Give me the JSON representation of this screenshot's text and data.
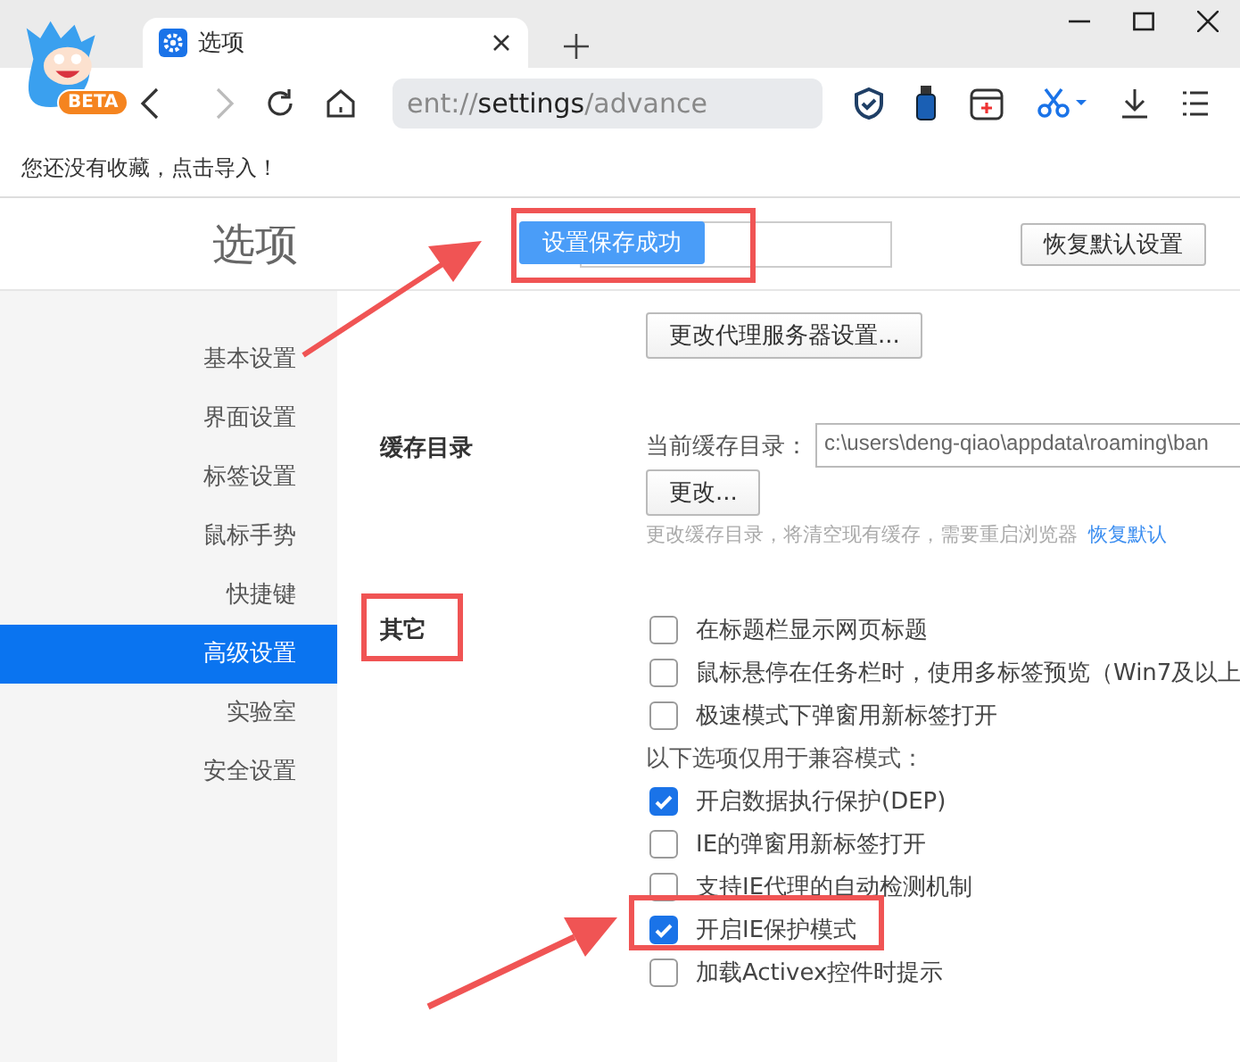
{
  "browser": {
    "logo_badge": "BETA",
    "tab_title": "选项",
    "address": {
      "scheme": "ent://",
      "host": "settings",
      "path": "/advance"
    },
    "forward_disabled": true,
    "bookmarks_hint": "您还没有收藏，点击导入！"
  },
  "header": {
    "title": "选项",
    "toast": "设置保存成功",
    "restore_button": "恢复默认设置"
  },
  "sidebar": {
    "items": [
      {
        "label": "基本设置",
        "selected": false
      },
      {
        "label": "界面设置",
        "selected": false
      },
      {
        "label": "标签设置",
        "selected": false
      },
      {
        "label": "鼠标手势",
        "selected": false
      },
      {
        "label": "快捷键",
        "selected": false
      },
      {
        "label": "高级设置",
        "selected": true
      },
      {
        "label": "实验室",
        "selected": false
      },
      {
        "label": "安全设置",
        "selected": false
      }
    ]
  },
  "proxy_button": "更改代理服务器设置...",
  "cache": {
    "label": "缓存目录",
    "field_label": "当前缓存目录：",
    "value": "c:\\users\\deng-qiao\\appdata\\roaming\\ban",
    "change_button": "更改...",
    "hint": "更改缓存目录，将清空现有缓存，需要重启浏览器",
    "restore_link": "恢复默认"
  },
  "other": {
    "label": "其它",
    "options": [
      {
        "kind": "checkbox",
        "label": "在标题栏显示网页标题",
        "checked": false
      },
      {
        "kind": "checkbox",
        "label": "鼠标悬停在任务栏时，使用多标签预览（Win7及以上",
        "checked": false
      },
      {
        "kind": "checkbox",
        "label": "极速模式下弹窗用新标签打开",
        "checked": false
      },
      {
        "kind": "note",
        "label": "以下选项仅用于兼容模式："
      },
      {
        "kind": "checkbox",
        "label": "开启数据执行保护(DEP)",
        "checked": true
      },
      {
        "kind": "checkbox",
        "label": "IE的弹窗用新标签打开",
        "checked": false
      },
      {
        "kind": "checkbox",
        "label": "支持IE代理的自动检测机制",
        "checked": false
      },
      {
        "kind": "checkbox",
        "label": "开启IE保护模式",
        "checked": true
      },
      {
        "kind": "checkbox",
        "label": "加载Activex控件时提示",
        "checked": false
      }
    ]
  }
}
